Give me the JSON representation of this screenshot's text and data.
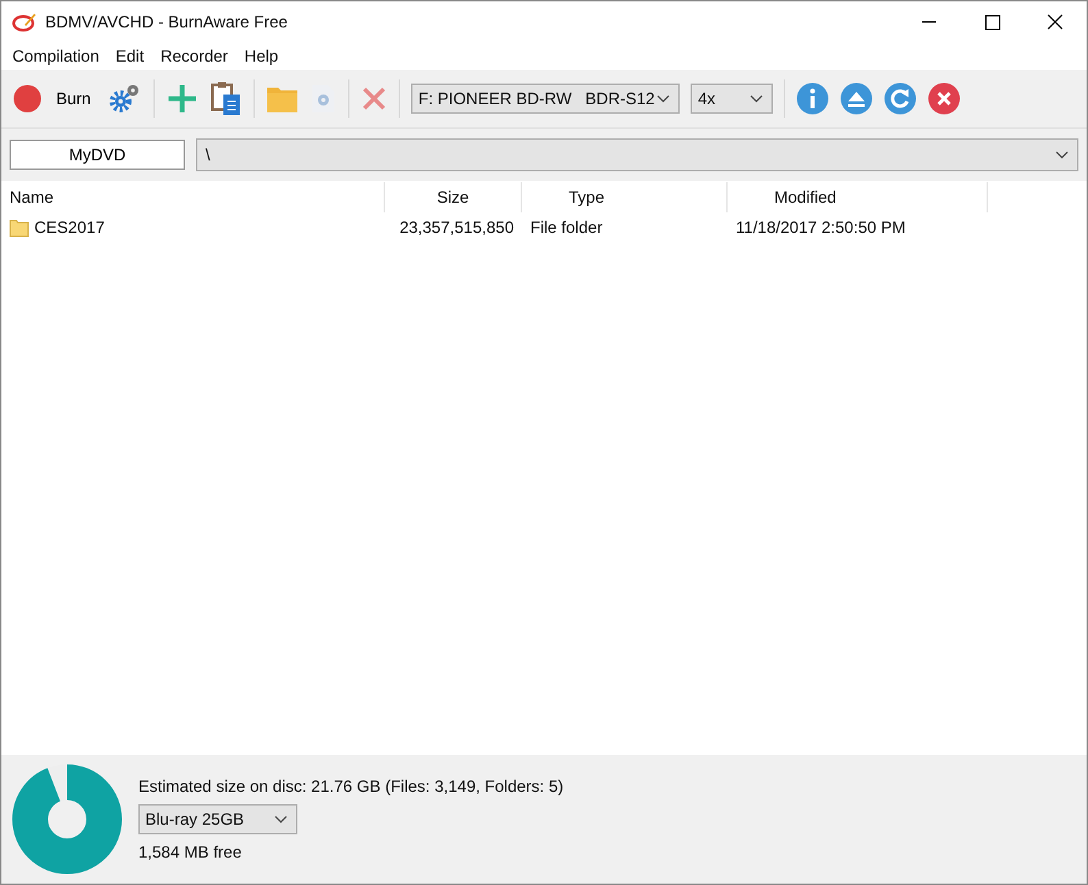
{
  "window": {
    "title": "BDMV/AVCHD - BurnAware Free"
  },
  "menu": [
    "Compilation",
    "Edit",
    "Recorder",
    "Help"
  ],
  "toolbar": {
    "burn_label": "Burn",
    "drive": "F: PIONEER BD-RW   BDR-S12",
    "speed": "4x"
  },
  "path_bar": {
    "disc_label": "MyDVD",
    "path": "\\"
  },
  "table": {
    "columns": [
      "Name",
      "Size",
      "Type",
      "Modified"
    ],
    "rows": [
      {
        "name": "CES2017",
        "size": "23,357,515,850",
        "type": "File folder",
        "modified": "11/18/2017 2:50:50 PM"
      }
    ]
  },
  "status": {
    "estimate": "Estimated size on disc: 21.76 GB (Files: 3,149, Folders: 5)",
    "disc_type": "Blu-ray 25GB",
    "free": "1,584 MB free",
    "level": 0.94
  }
}
